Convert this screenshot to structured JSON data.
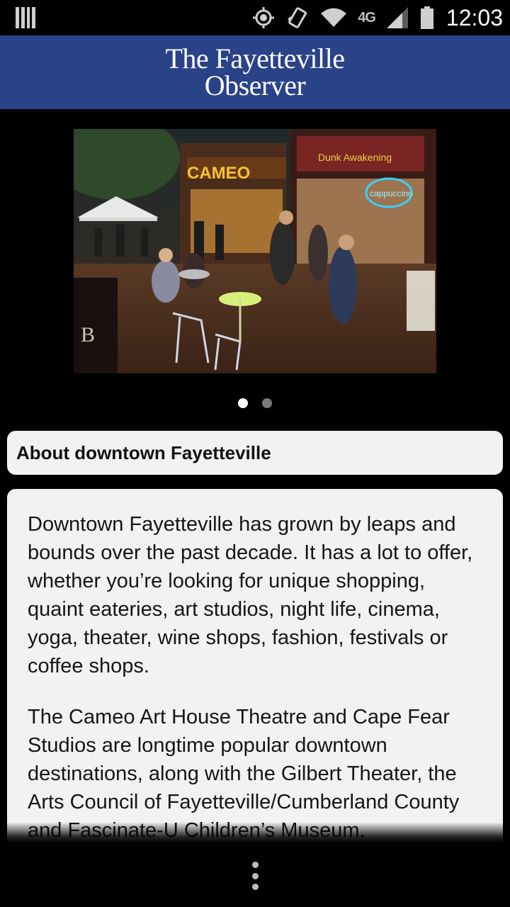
{
  "status_bar": {
    "network_label": "4G",
    "network_sub": "LTE",
    "time": "12:03",
    "icons": [
      "notification-bars-icon",
      "gps-icon",
      "vibrate-icon",
      "wifi-icon",
      "signal-icon",
      "battery-icon"
    ]
  },
  "masthead": {
    "line1": "The Fayetteville",
    "line2": "Observer",
    "background_color": "#2a4287"
  },
  "gallery": {
    "image_description_icon": "downtown-street-photo",
    "page_count": 2,
    "active_page": 1
  },
  "section": {
    "title": "About downtown Fayetteville"
  },
  "article": {
    "paragraphs": [
      "Downtown Fayetteville has grown by leaps and bounds over the past decade. It has a lot to offer, whether you’re looking for unique shopping, quaint eateries, art studios, night life, cinema, yoga, theater, wine shops, fashion, festivals or coffee shops.",
      "The Cameo Art House Theatre and Cape Fear Studios are longtime popular downtown destinations, along with the Gilbert Theater, the Arts Council of Fayetteville/Cumberland County and Fascinate-U Children’s Museum."
    ]
  },
  "bottom_bar": {
    "menu_icon": "overflow-menu-icon"
  }
}
